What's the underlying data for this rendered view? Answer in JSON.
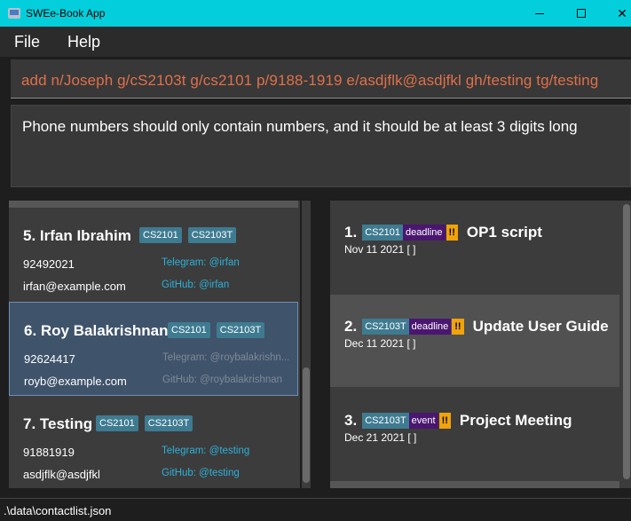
{
  "window": {
    "title": "SWEe-Book App",
    "buttons": {
      "minimize": "minimize",
      "maximize": "maximize",
      "close": "✕"
    }
  },
  "menu": {
    "file": "File",
    "help": "Help"
  },
  "command_box": {
    "value": "add n/Joseph g/cS2103t g/cs2101 p/9188-1919 e/asdjflk@asdjfkl gh/testing tg/testing"
  },
  "result": {
    "text": "Phone numbers should only contain numbers, and it should be at least 3 digits long"
  },
  "persons": [
    {
      "name": "5.  Irfan Ibrahim",
      "tags": [
        "CS2101",
        "CS2103T"
      ],
      "phone": "92492021",
      "email": "irfan@example.com",
      "telegram": "Telegram: @irfan",
      "github": "GitHub: @irfan"
    },
    {
      "name": "6.  Roy Balakrishnan",
      "tags": [
        "CS2101",
        "CS2103T"
      ],
      "phone": "92624417",
      "email": "royb@example.com",
      "telegram": "Telegram: @roybalakrishn...",
      "github": "GitHub: @roybalakrishnan"
    },
    {
      "name": "7.  Testing",
      "tags": [
        "CS2101",
        "CS2103T"
      ],
      "phone": "91881919",
      "email": "asdjflk@asdjfkl",
      "telegram": "Telegram: @testing",
      "github": "GitHub: @testing"
    }
  ],
  "events": [
    {
      "index": "1.",
      "tag": "CS2101",
      "type": "deadline",
      "importance": "!!",
      "title": "OP1 script",
      "date": "Nov 11 2021 [ ]"
    },
    {
      "index": "2.",
      "tag": "CS2103T",
      "type": "deadline",
      "importance": "!!",
      "title": "Update User Guide",
      "date": "Dec 11 2021 [ ]"
    },
    {
      "index": "3.",
      "tag": "CS2103T",
      "type": "event",
      "importance": "!!",
      "title": "Project Meeting",
      "date": "Dec 21 2021 [ ]"
    }
  ],
  "status": {
    "path": ".\\data\\contactlist.json"
  },
  "colors": {
    "titlebar": "#03cfdc",
    "command_text": "#e0704a",
    "tag": "#3e7b91",
    "event_type": "#4a1670",
    "importance": "#f0a30a",
    "link": "#2cb1d8",
    "selected_card": "#3f536b"
  }
}
